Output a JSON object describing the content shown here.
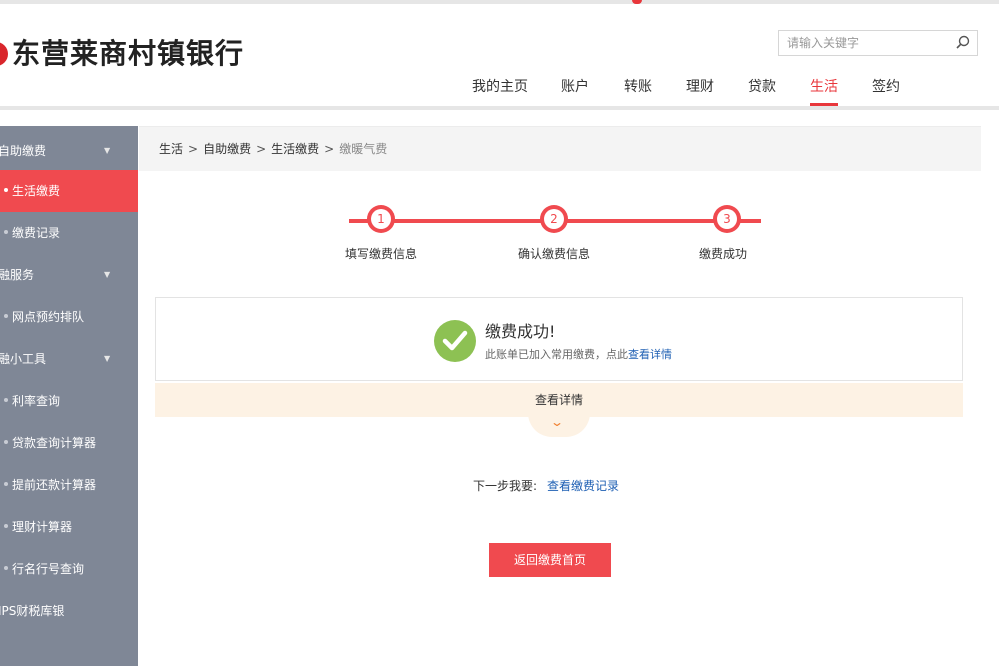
{
  "brand": {
    "name": "东营莱商村镇银行",
    "color": "#d9262c"
  },
  "search": {
    "placeholder": "请输入关键字",
    "icon": "search-icon"
  },
  "nav": {
    "items": [
      "我的主页",
      "账户",
      "转账",
      "理财",
      "贷款",
      "生活",
      "签约"
    ],
    "active": "生活"
  },
  "sidebar": {
    "groups": [
      {
        "label": "自助缴费",
        "items": [
          "生活缴费",
          "缴费记录"
        ]
      },
      {
        "label": "金融服务",
        "items": [
          "网点预约排队"
        ]
      },
      {
        "label": "金融小工具",
        "items": [
          "利率查询",
          "贷款查询计算器",
          "提前还款计算器",
          "理财计算器",
          "行名行号查询"
        ]
      }
    ],
    "tail_item": "TIPS财税库银",
    "active_item": "生活缴费",
    "group_label_visible": [
      "自助缴费",
      "融服务",
      "融小工具"
    ],
    "tail_label_visible": "IPS财税库银"
  },
  "breadcrumb": [
    "生活",
    "自助缴费",
    "生活缴费",
    "缴暖气费"
  ],
  "steps": [
    {
      "num": "1",
      "label": "填写缴费信息"
    },
    {
      "num": "2",
      "label": "确认缴费信息"
    },
    {
      "num": "3",
      "label": "缴费成功"
    }
  ],
  "result": {
    "title": "缴费成功!",
    "desc": "此账单已加入常用缴费，点此",
    "desc_link": "查看详情",
    "icon": "check-icon"
  },
  "detail_toggle": {
    "label": "查看详情",
    "icon": "chevron-down-icon"
  },
  "next_step": {
    "label": "下一步我要:",
    "link": "查看缴费记录"
  },
  "back_button": "返回缴费首页",
  "colors": {
    "accent": "#f04a4f",
    "link": "#1e5fb3",
    "success": "#8dc153",
    "sidebar": "#7f8796"
  }
}
